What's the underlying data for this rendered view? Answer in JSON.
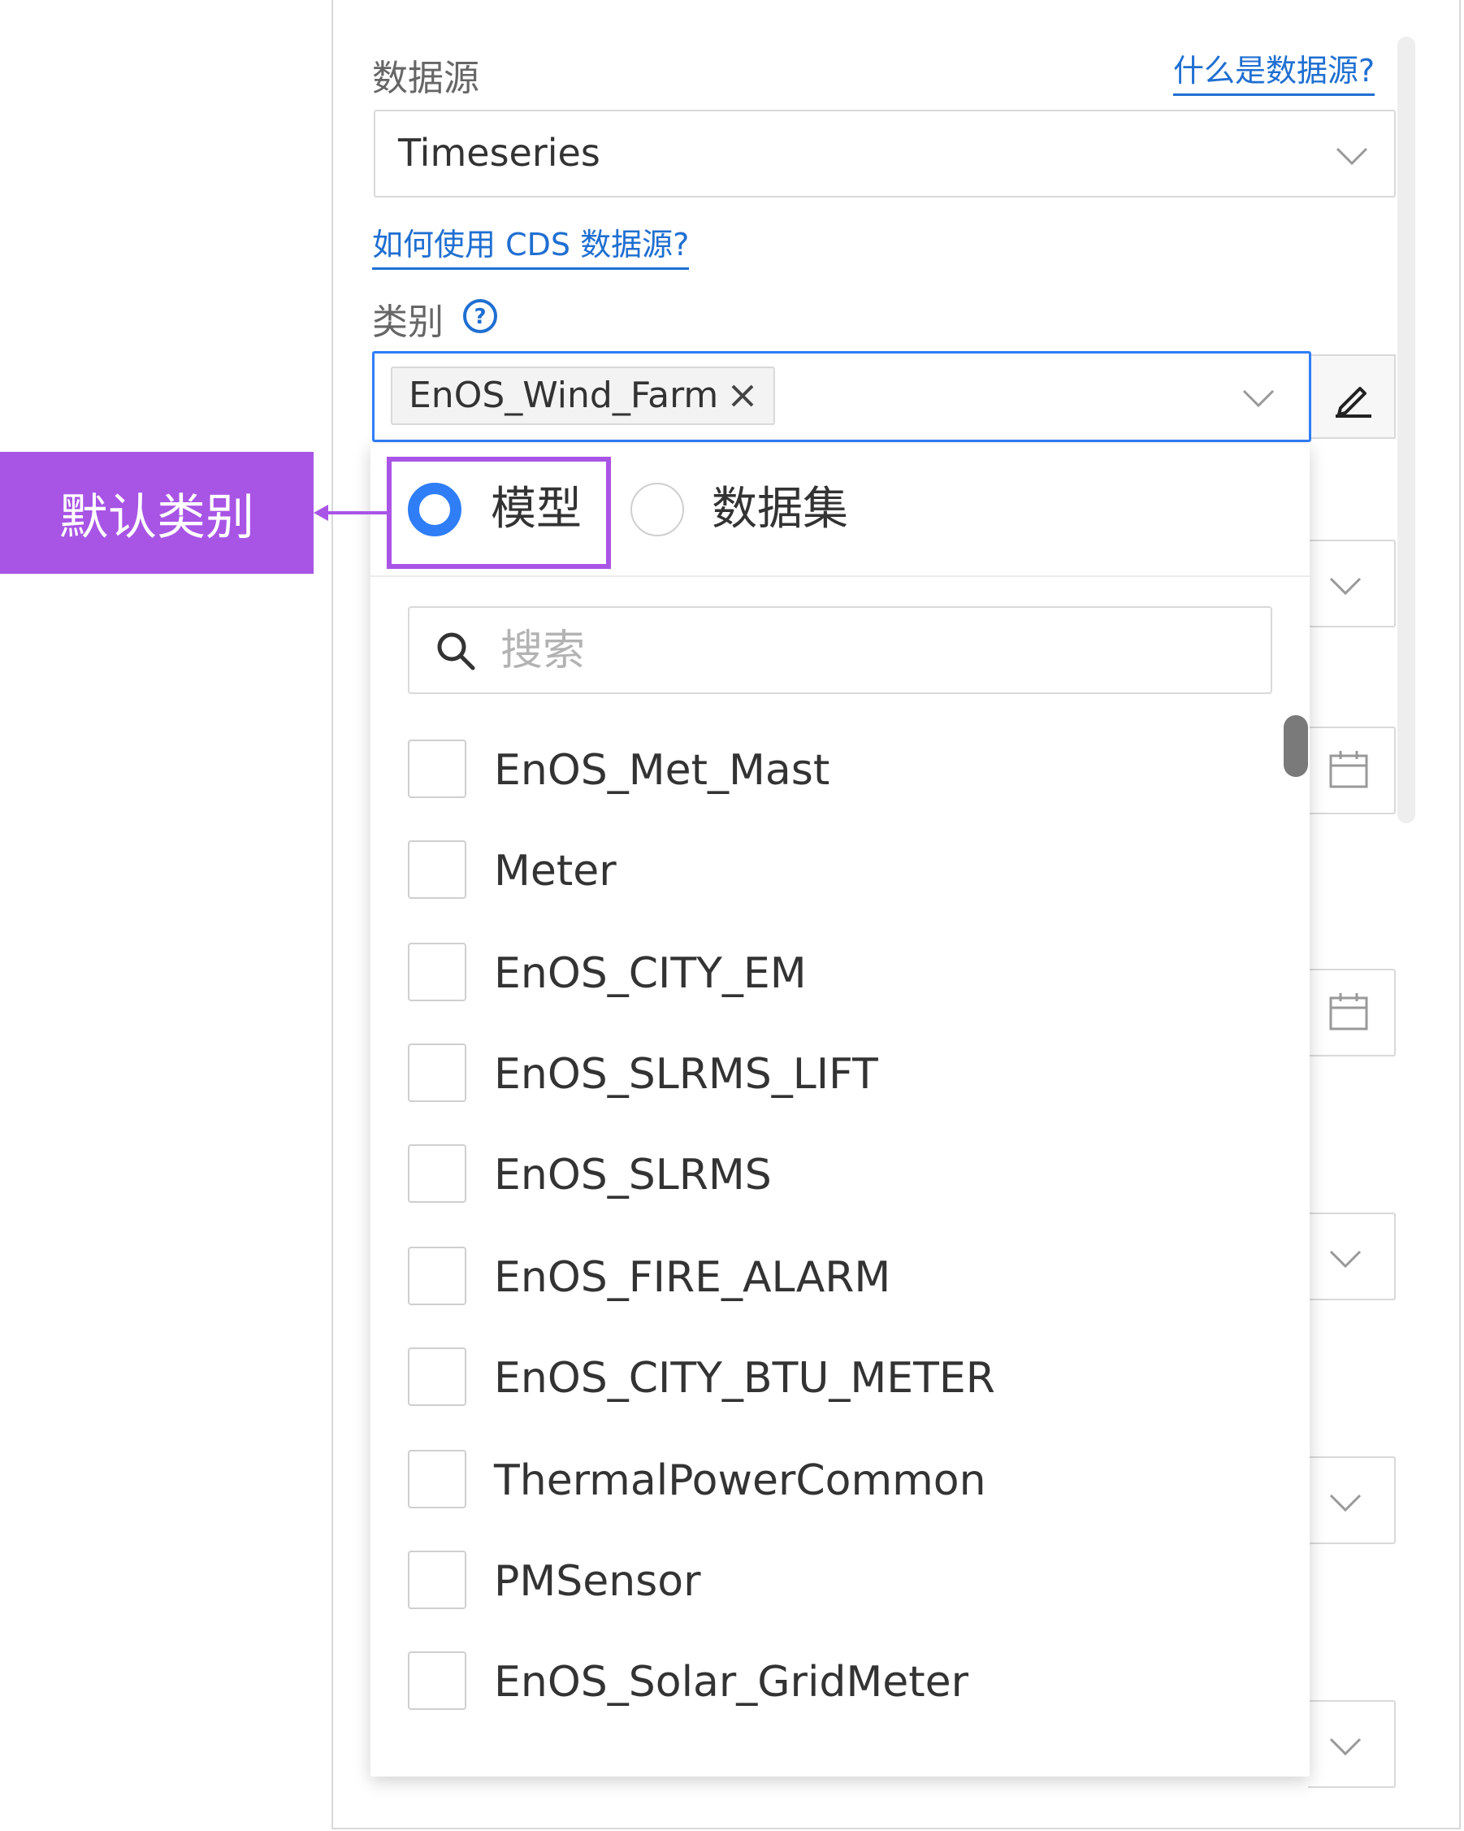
{
  "datasource": {
    "label": "数据源",
    "help_link": "什么是数据源?",
    "value": "Timeseries",
    "cds_link": "如何使用 CDS 数据源?"
  },
  "category": {
    "label": "类别",
    "selected_tag": "EnOS_Wind_Farm"
  },
  "dropdown": {
    "radio_options": [
      "模型",
      "数据集"
    ],
    "selected_radio": "模型",
    "search_placeholder": "搜索",
    "items": [
      "EnOS_Met_Mast",
      "Meter",
      "EnOS_CITY_EM",
      "EnOS_SLRMS_LIFT",
      "EnOS_SLRMS",
      "EnOS_FIRE_ALARM",
      "EnOS_CITY_BTU_METER",
      "ThermalPowerCommon",
      "PMSensor",
      "EnOS_Solar_GridMeter"
    ]
  },
  "annotation": {
    "label": "默认类别"
  },
  "colors": {
    "accent": "#2f7ef7",
    "link": "#1f6fd1",
    "annotation": "#a855e6"
  }
}
